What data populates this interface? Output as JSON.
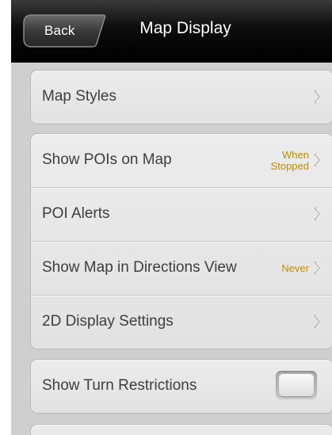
{
  "navbar": {
    "back_label": "Back",
    "title": "Map Display"
  },
  "groups": [
    {
      "rows": [
        {
          "label": "Map Styles",
          "value": "",
          "icon": "chevron-right-icon"
        }
      ]
    },
    {
      "rows": [
        {
          "label": "Show POIs on Map",
          "value_line1": "When",
          "value_line2": "Stopped",
          "icon": "chevron-right-icon"
        },
        {
          "label": "POI Alerts",
          "value": "",
          "icon": "chevron-right-icon"
        },
        {
          "label": "Show Map in Directions View",
          "value": "Never",
          "icon": "chevron-right-icon"
        },
        {
          "label": "2D Display Settings",
          "value": "",
          "icon": "chevron-right-icon"
        }
      ]
    },
    {
      "rows": [
        {
          "label": "Show Turn Restrictions",
          "control": "toggle",
          "toggle_on": false
        }
      ]
    }
  ],
  "colors": {
    "value_accent": "#b98e07",
    "navbar_bg": "#000000",
    "screen_bg": "#cfcfcf"
  }
}
